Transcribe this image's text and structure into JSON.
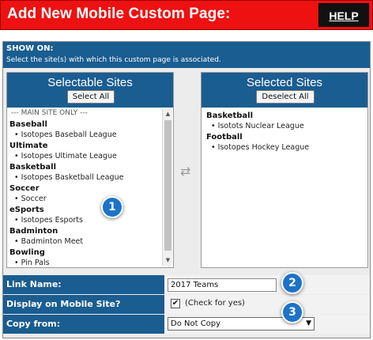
{
  "header": {
    "title": "Add New Mobile Custom Page:",
    "help_label": "HELP"
  },
  "show_on": {
    "title": "SHOW ON:",
    "description": "Select the site(s) with which this custom page is associated."
  },
  "selectable": {
    "title": "Selectable Sites",
    "button_label": "Select All",
    "separator": "--- MAIN SITE ONLY ---",
    "groups": [
      {
        "name": "Baseball",
        "items": [
          "Isotopes Baseball League"
        ]
      },
      {
        "name": "Ultimate",
        "items": [
          "Isotopes Ultimate League"
        ]
      },
      {
        "name": "Basketball",
        "items": [
          "Isotopes Basketball League"
        ]
      },
      {
        "name": "Soccer",
        "items": [
          "Soccer"
        ]
      },
      {
        "name": "eSports",
        "items": [
          "Isotopes Esports"
        ]
      },
      {
        "name": "Badminton",
        "items": [
          "Badminton Meet"
        ]
      },
      {
        "name": "Bowling",
        "items": [
          "Pin Pals"
        ]
      }
    ]
  },
  "selected": {
    "title": "Selected Sites",
    "button_label": "Deselect All",
    "groups": [
      {
        "name": "Basketball",
        "items": [
          "Isotots Nuclear League"
        ]
      },
      {
        "name": "Football",
        "items": [
          "Isotopes Hockey League"
        ]
      }
    ]
  },
  "form": {
    "link_name_label": "Link Name:",
    "link_name_value": "2017 Teams",
    "display_label": "Display on Mobile Site?",
    "display_hint": "(Check for yes)",
    "copy_label": "Copy from:",
    "copy_value": "Do Not Copy"
  },
  "callouts": [
    "1",
    "2",
    "3"
  ],
  "icons": {
    "bullet": "•",
    "check": "✔",
    "transfer": "⇄",
    "dropdown": "▼",
    "scroll_up": "▲",
    "scroll_down": "▼"
  },
  "colors": {
    "header_red": "#ee1111",
    "panel_blue": "#1a5d91",
    "badge_blue": "#1d73c9"
  }
}
